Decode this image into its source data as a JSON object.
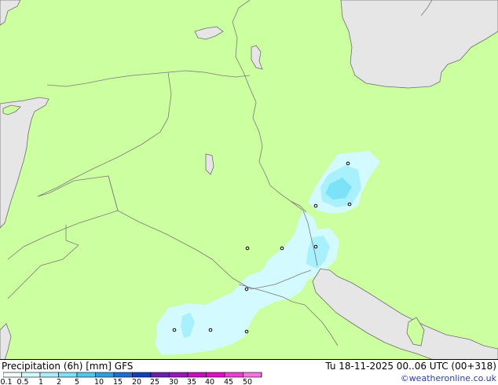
{
  "map": {
    "colors": {
      "land": "#ccff9f",
      "sea": "#e6e6e6",
      "border": "#7a7a7a",
      "coast": "#6e6e6e"
    },
    "stations": [
      "station",
      "station",
      "station",
      "station",
      "station",
      "station",
      "station",
      "station",
      "station",
      "station",
      "station"
    ]
  },
  "footer": {
    "title": "Precipitation (6h) [mm] GFS",
    "timestamp": "Tu 18-11-2025 00..06 UTC (00+318)",
    "credit": "©weatheronline.co.uk"
  },
  "legend": {
    "ticks": [
      "0.1",
      "0.5",
      "1",
      "2",
      "5",
      "10",
      "15",
      "20",
      "25",
      "30",
      "35",
      "40",
      "45",
      "50"
    ],
    "colors": [
      "#f5fefe",
      "#d3fafe",
      "#a8f0fc",
      "#7ce2f8",
      "#50c6f0",
      "#2e9fe4",
      "#1c6fd6",
      "#1040bc",
      "#6a1fb0",
      "#9d16bb",
      "#c40fc4",
      "#dc10cc",
      "#ea3ed6",
      "#f474e2"
    ]
  }
}
